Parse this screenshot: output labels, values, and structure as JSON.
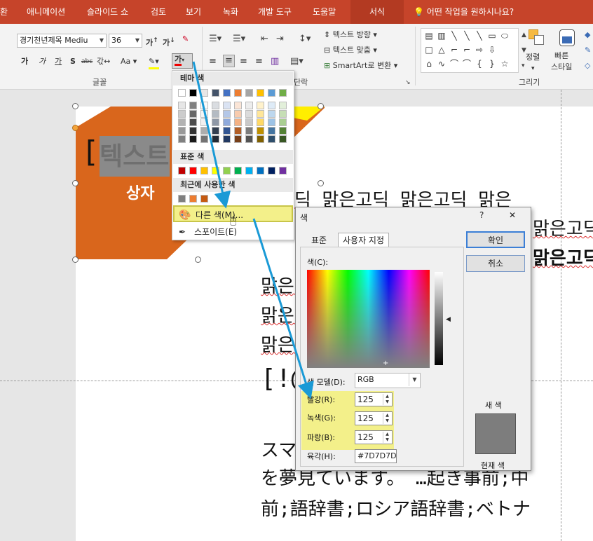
{
  "ribbon": {
    "tabs": [
      "환",
      "애니메이션",
      "슬라이드 쇼",
      "검토",
      "보기",
      "녹화",
      "개발 도구",
      "도움말",
      "서식"
    ],
    "tell_me": "어떤 작업을 원하시나요?",
    "font_name": "경기천년제목 Mediu",
    "font_size": "36",
    "font_group_label": "글꼴",
    "paragraph_group_label": "단락",
    "drawing_group_label": "그리기",
    "text_direction": "텍스트 방향",
    "align_text": "텍스트 맞춤",
    "smartart": "SmartArt로 변환",
    "arrange": "정렬",
    "quick_styles": "빠른\n스타일"
  },
  "slide": {
    "shape_bracket": "[",
    "shape_text": "텍스트",
    "shape_subtext": "상자",
    "lines": [
      "은고딕 맑은고딕 맑은고딕 맑은",
      "맑은고딕",
      "맑은고딕",
      "맑은  IC 맑은",
      "맑은  맑은고",
      "맑은  은고딕",
      "[!@  +-=",
      "スマ  言語の",
      "を夢見ています。 …起き事前;中",
      "前;語辞書;ロシア語辞書;ベトナ"
    ]
  },
  "color_menu": {
    "theme_label": "테마 색",
    "standard_label": "표준 색",
    "recent_label": "최근에 사용한 색",
    "more_colors": "다른 색(M)...",
    "eyedropper": "스포이트(E)",
    "theme_top": [
      "#ffffff",
      "#000000",
      "#e7e6e6",
      "#44546a",
      "#4472c4",
      "#ed7d31",
      "#a5a5a5",
      "#ffc000",
      "#5b9bd5",
      "#70ad47"
    ],
    "standard": [
      "#c00000",
      "#ff0000",
      "#ffc000",
      "#ffff00",
      "#92d050",
      "#00b050",
      "#00b0f0",
      "#0070c0",
      "#002060",
      "#7030a0"
    ],
    "recent": [
      "#7f7f7f",
      "#ed7d31",
      "#c55a11"
    ]
  },
  "dialog": {
    "title": "색",
    "help": "?",
    "close": "✕",
    "tab_standard": "표준",
    "tab_custom": "사용자 지정",
    "colors_label": "색(C):",
    "model_label": "색 모델(D):",
    "model_value": "RGB",
    "red_label": "빨강(R):",
    "red_value": "125",
    "green_label": "녹색(G):",
    "green_value": "125",
    "blue_label": "파랑(B):",
    "blue_value": "125",
    "hex_label": "육각(H):",
    "hex_value": "#7D7D7D",
    "ok": "확인",
    "cancel": "취소",
    "new_label": "새 색",
    "current_label": "현재 색",
    "new_color": "#7d7d7d"
  }
}
